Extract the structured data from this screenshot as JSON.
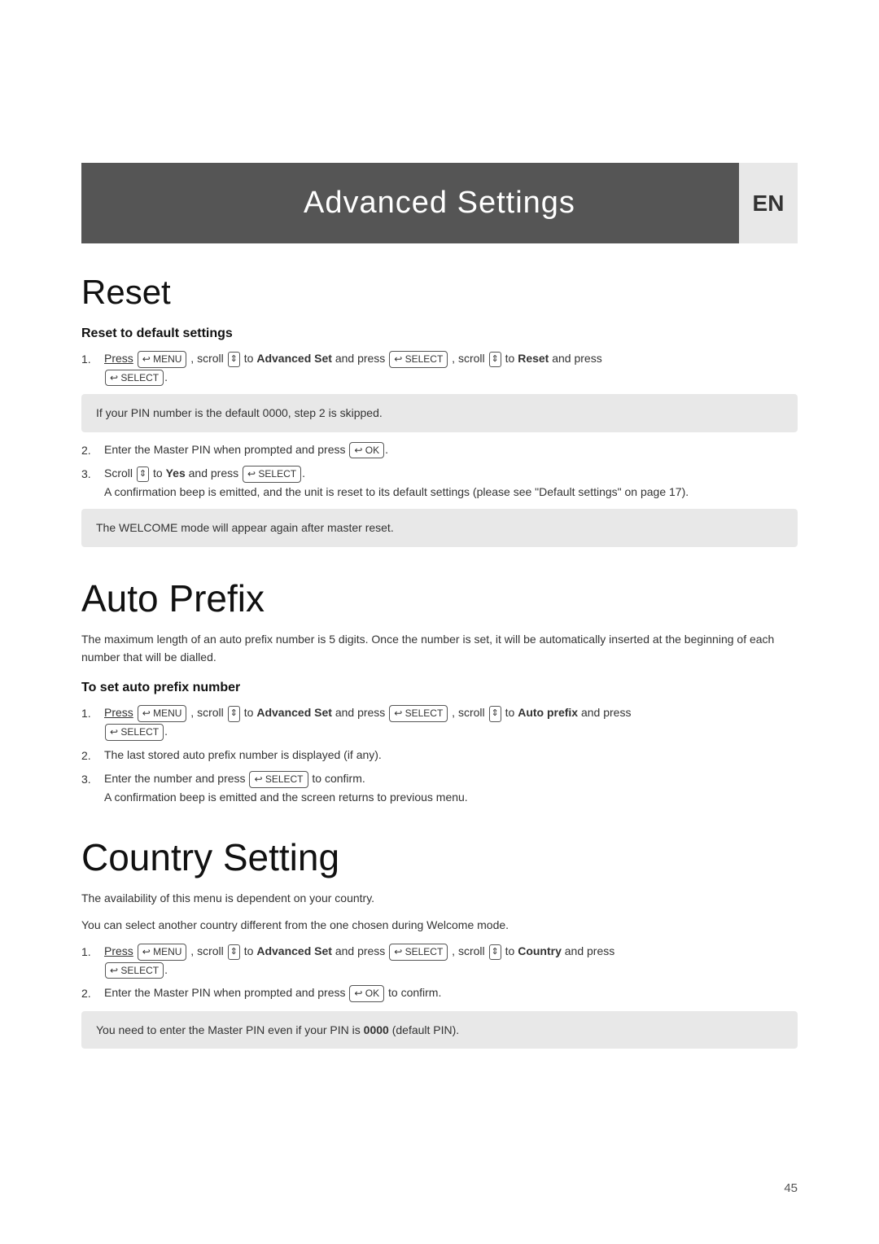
{
  "header": {
    "title": "Advanced Settings",
    "lang_badge": "EN"
  },
  "page_number": "45",
  "sections": {
    "reset": {
      "title": "Reset",
      "subsection": "Reset to default settings",
      "steps": [
        {
          "number": "1.",
          "text_parts": [
            {
              "type": "text_underline",
              "value": "Press"
            },
            {
              "type": "btn",
              "value": "MENU"
            },
            {
              "type": "text",
              "value": ", scroll"
            },
            {
              "type": "scroll",
              "value": "↕"
            },
            {
              "type": "text",
              "value": "to"
            },
            {
              "type": "bold",
              "value": "Advanced Set"
            },
            {
              "type": "text",
              "value": "and press"
            },
            {
              "type": "btn",
              "value": "SELECT"
            },
            {
              "type": "text",
              "value": ", scroll"
            },
            {
              "type": "scroll",
              "value": "↕"
            },
            {
              "type": "text",
              "value": "to"
            },
            {
              "type": "bold",
              "value": "Reset"
            },
            {
              "type": "text",
              "value": "and press"
            },
            {
              "type": "btn",
              "value": "SELECT"
            }
          ]
        },
        {
          "number": "2.",
          "text": "Enter the Master PIN when prompted and press"
        },
        {
          "number": "3.",
          "text_parts": [
            {
              "type": "text",
              "value": "Scroll"
            },
            {
              "type": "scroll",
              "value": "↕"
            },
            {
              "type": "text",
              "value": "to"
            },
            {
              "type": "bold",
              "value": "Yes"
            },
            {
              "type": "text",
              "value": "and press"
            },
            {
              "type": "btn",
              "value": "SELECT"
            }
          ],
          "subtext": "A confirmation beep is emitted, and the unit is reset to its default settings (please see \"Default settings\" on page 17)."
        }
      ],
      "note1": "If your PIN number is the default 0000, step 2 is skipped.",
      "note2": "The WELCOME mode will appear again after master reset."
    },
    "auto_prefix": {
      "title": "Auto Prefix",
      "intro": "The maximum length of an auto prefix number is 5 digits. Once the number is set, it will be automatically inserted at the beginning of each number that will be dialled.",
      "subsection": "To set auto prefix number",
      "steps": [
        {
          "number": "1.",
          "text": "Press MENU, scroll to Advanced Set and press SELECT, scroll to Auto prefix and press SELECT."
        },
        {
          "number": "2.",
          "text": "The last stored auto prefix number is displayed (if any)."
        },
        {
          "number": "3.",
          "text": "Enter the number and press SELECT to confirm.",
          "subtext": "A confirmation beep is emitted and the screen returns to previous menu."
        }
      ]
    },
    "country_setting": {
      "title": "Country Setting",
      "intro1": "The availability of this menu is dependent on your country.",
      "intro2": "You can select another country different from the one chosen during Welcome mode.",
      "steps": [
        {
          "number": "1.",
          "text": "Press MENU, scroll to Advanced Set and press SELECT, scroll to Country and press SELECT."
        },
        {
          "number": "2.",
          "text": "Enter the Master PIN when prompted and press OK to confirm."
        }
      ],
      "note": "You need to enter the Master PIN even if your PIN is 0000 (default PIN)."
    }
  }
}
